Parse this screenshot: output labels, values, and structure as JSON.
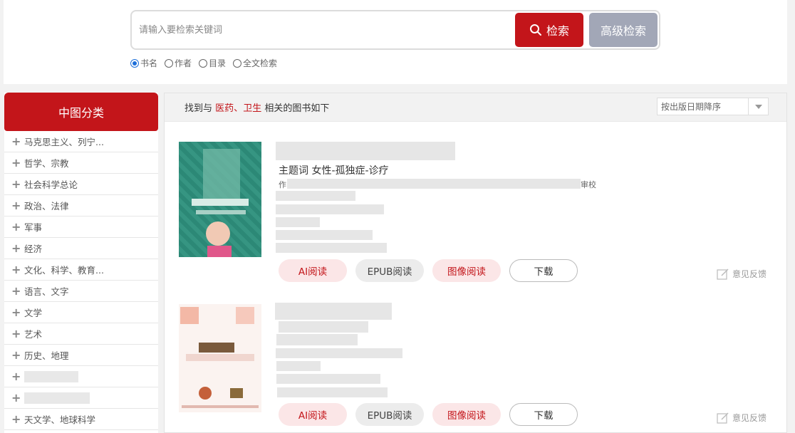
{
  "search": {
    "placeholder": "请输入要检索关键词",
    "search_label": "检索",
    "advanced_label": "高级检索",
    "options": [
      "书名",
      "作者",
      "目录",
      "全文检索"
    ],
    "selected": "书名"
  },
  "sidebar": {
    "title": "中图分类",
    "items": [
      {
        "label": "马克思主义、列宁..."
      },
      {
        "label": "哲学、宗教"
      },
      {
        "label": "社会科学总论"
      },
      {
        "label": "政治、法律"
      },
      {
        "label": "军事"
      },
      {
        "label": "经济"
      },
      {
        "label": "文化、科学、教育..."
      },
      {
        "label": "语言、文字"
      },
      {
        "label": "文学"
      },
      {
        "label": "艺术"
      },
      {
        "label": "历史、地理"
      },
      {
        "label": ""
      },
      {
        "label": ""
      },
      {
        "label": "天文学、地球科学"
      }
    ]
  },
  "results": {
    "prefix": "找到与",
    "keyword1": "医药",
    "separator": "、",
    "keyword2": "卫生",
    "suffix": "相关的图书如下",
    "sort_label": "按出版日期降序"
  },
  "books": [
    {
      "subject": "主题词 女性-孤独症-诊疗",
      "partial_text_start": "作",
      "partial_text_end": "审校",
      "buttons": {
        "ai": "AI阅读",
        "epub": "EPUB阅读",
        "image": "图像阅读",
        "download": "下载"
      },
      "feedback": "意见反馈"
    },
    {
      "subject": "",
      "buttons": {
        "ai": "AI阅读",
        "epub": "EPUB阅读",
        "image": "图像阅读",
        "download": "下载"
      },
      "feedback": "意见反馈"
    }
  ],
  "colors": {
    "accent": "#c3151a",
    "advanced_button": "#a2a7b7",
    "pill_bg": "#fbe6e7"
  }
}
